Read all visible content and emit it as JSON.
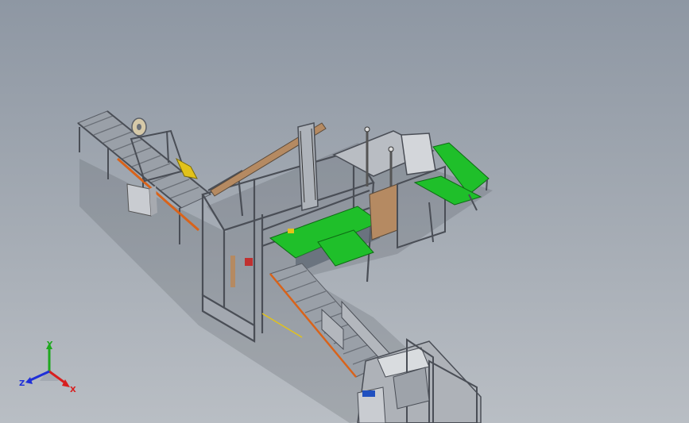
{
  "view": {
    "background_top": "#8e97a3",
    "background_bottom": "#b9bec4"
  },
  "model": {
    "frame_color": "#7d8089",
    "conveyor_green": "#1fbf2a",
    "accent_orange": "#d9631a",
    "accent_yellow": "#e2c21a",
    "cabinet_gray": "#c9ccd1"
  },
  "triad": {
    "x_label": "X",
    "y_label": "Y",
    "z_label": "Z",
    "x_color": "#d81f1f",
    "y_color": "#1fa81f",
    "z_color": "#1f2fd8"
  }
}
